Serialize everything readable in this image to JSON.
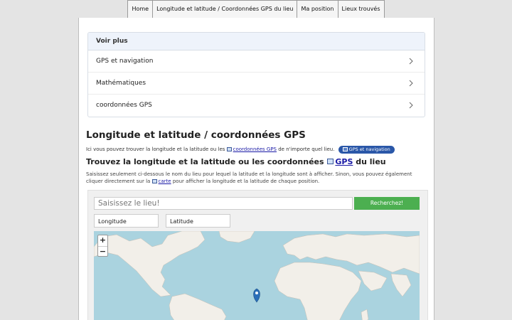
{
  "nav": {
    "items": [
      "Home",
      "Longitude et latitude / Coordonnées GPS du lieu",
      "Ma position",
      "Lieux trouvés"
    ]
  },
  "voir_plus": {
    "title": "Voir plus",
    "items": [
      "GPS et navigation",
      "Mathématiques",
      "coordonnées GPS"
    ]
  },
  "main": {
    "title": "Longitude et latitude / coordonnées GPS",
    "intro_before": "Ici vous pouvez trouver la longitude et la latitude ou les",
    "intro_link": "coordonnées GPS",
    "intro_after": "de n'importe quel lieu.",
    "badge": "GPS et navigation",
    "subtitle_before": "Trouvez la longitude et la latitude ou les coordonnées",
    "subtitle_link": "GPS",
    "subtitle_after": "du lieu",
    "desc_before": "Saisissez seulement ci-dessous le nom du lieu pour lequel la latitude et la longitude sont à afficher. Sinon, vous pouvez également cliquer directement sur la",
    "desc_link": "carte",
    "desc_after": "pour afficher la longitude et la latitude de chaque position."
  },
  "search": {
    "placeholder": "Saisissez le lieu!",
    "button": "Recherchez!",
    "longitude_label": "Longitude",
    "latitude_label": "Latitude"
  },
  "map": {
    "zoom_in": "+",
    "zoom_out": "−",
    "marker_color": "#2b6fb8",
    "water_color": "#aad3df",
    "land_color": "#f2efe9"
  },
  "colors": {
    "accent_button": "#4caf50",
    "badge": "#2a57a8",
    "link": "#1a1aa6"
  }
}
